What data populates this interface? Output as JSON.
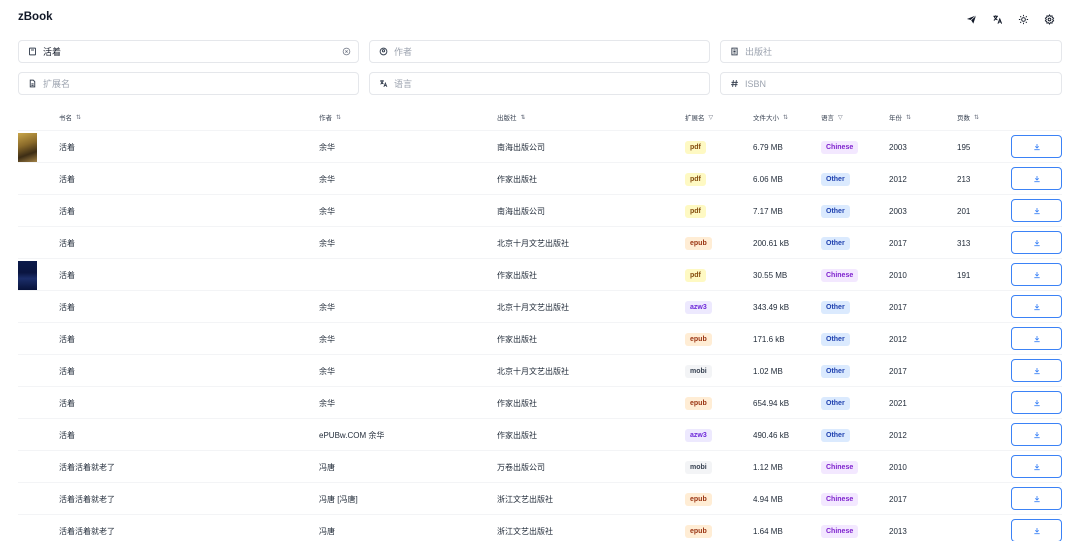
{
  "app": {
    "title": "zBook"
  },
  "top_icons": [
    "send-icon",
    "translate-icon",
    "sun-icon",
    "settings-icon"
  ],
  "filters": {
    "title": {
      "value": "活着",
      "placeholder": ""
    },
    "author": {
      "value": "",
      "placeholder": "作者"
    },
    "publisher": {
      "value": "",
      "placeholder": "出版社"
    },
    "extension": {
      "value": "",
      "placeholder": "扩展名"
    },
    "language": {
      "value": "",
      "placeholder": "语言"
    },
    "isbn": {
      "value": "",
      "placeholder": "ISBN"
    }
  },
  "columns": {
    "title": "书名",
    "author": "作者",
    "publisher": "出版社",
    "extension": "扩展名",
    "filesize": "文件大小",
    "language": "语言",
    "year": "年份",
    "pages": "页数",
    "sort_glyph": "⇅",
    "filter_glyph": "▽"
  },
  "colors": {
    "pdf": [
      "#fef9c3",
      "#854d0e"
    ],
    "epub": [
      "#ffedd5",
      "#9a3412"
    ],
    "azw3": [
      "#ede9fe",
      "#6d28d9"
    ],
    "mobi": [
      "#f3f4f6",
      "#374151"
    ],
    "Chinese": [
      "#f3e8ff",
      "#7e22ce"
    ],
    "Other": [
      "#dbeafe",
      "#1e40af"
    ],
    "accent": "#3b82f6"
  },
  "rows": [
    {
      "cover": "yellow",
      "title": "活着",
      "author": "余华",
      "publisher": "南海出版公司",
      "ext": "pdf",
      "size": "6.79 MB",
      "lang": "Chinese",
      "year": "2003",
      "pages": "195"
    },
    {
      "cover": "",
      "title": "活着",
      "author": "余华",
      "publisher": "作家出版社",
      "ext": "pdf",
      "size": "6.06 MB",
      "lang": "Other",
      "year": "2012",
      "pages": "213"
    },
    {
      "cover": "",
      "title": "活着",
      "author": "余华",
      "publisher": "南海出版公司",
      "ext": "pdf",
      "size": "7.17 MB",
      "lang": "Other",
      "year": "2003",
      "pages": "201"
    },
    {
      "cover": "",
      "title": "活着",
      "author": "余华",
      "publisher": "北京十月文艺出版社",
      "ext": "epub",
      "size": "200.61 kB",
      "lang": "Other",
      "year": "2017",
      "pages": "313"
    },
    {
      "cover": "navy",
      "title": "活着",
      "author": "",
      "publisher": "作家出版社",
      "ext": "pdf",
      "size": "30.55 MB",
      "lang": "Chinese",
      "year": "2010",
      "pages": "191"
    },
    {
      "cover": "",
      "title": "活着",
      "author": "余华",
      "publisher": "北京十月文艺出版社",
      "ext": "azw3",
      "size": "343.49 kB",
      "lang": "Other",
      "year": "2017",
      "pages": ""
    },
    {
      "cover": "",
      "title": "活着",
      "author": "余华",
      "publisher": "作家出版社",
      "ext": "epub",
      "size": "171.6 kB",
      "lang": "Other",
      "year": "2012",
      "pages": ""
    },
    {
      "cover": "",
      "title": "活着",
      "author": "余华",
      "publisher": "北京十月文艺出版社",
      "ext": "mobi",
      "size": "1.02 MB",
      "lang": "Other",
      "year": "2017",
      "pages": ""
    },
    {
      "cover": "",
      "title": "活着",
      "author": "余华",
      "publisher": "作家出版社",
      "ext": "epub",
      "size": "654.94 kB",
      "lang": "Other",
      "year": "2021",
      "pages": ""
    },
    {
      "cover": "",
      "title": "活着",
      "author": "ePUBw.COM 余华",
      "publisher": "作家出版社",
      "ext": "azw3",
      "size": "490.46 kB",
      "lang": "Other",
      "year": "2012",
      "pages": ""
    },
    {
      "cover": "",
      "title": "活着活着就老了",
      "author": "冯唐",
      "publisher": "万卷出版公司",
      "ext": "mobi",
      "size": "1.12 MB",
      "lang": "Chinese",
      "year": "2010",
      "pages": ""
    },
    {
      "cover": "",
      "title": "活着活着就老了",
      "author": "冯唐 [冯唐]",
      "publisher": "浙江文艺出版社",
      "ext": "epub",
      "size": "4.94 MB",
      "lang": "Chinese",
      "year": "2017",
      "pages": ""
    },
    {
      "cover": "",
      "title": "活着活着就老了",
      "author": "冯唐",
      "publisher": "浙江文艺出版社",
      "ext": "epub",
      "size": "1.64 MB",
      "lang": "Chinese",
      "year": "2013",
      "pages": ""
    }
  ]
}
